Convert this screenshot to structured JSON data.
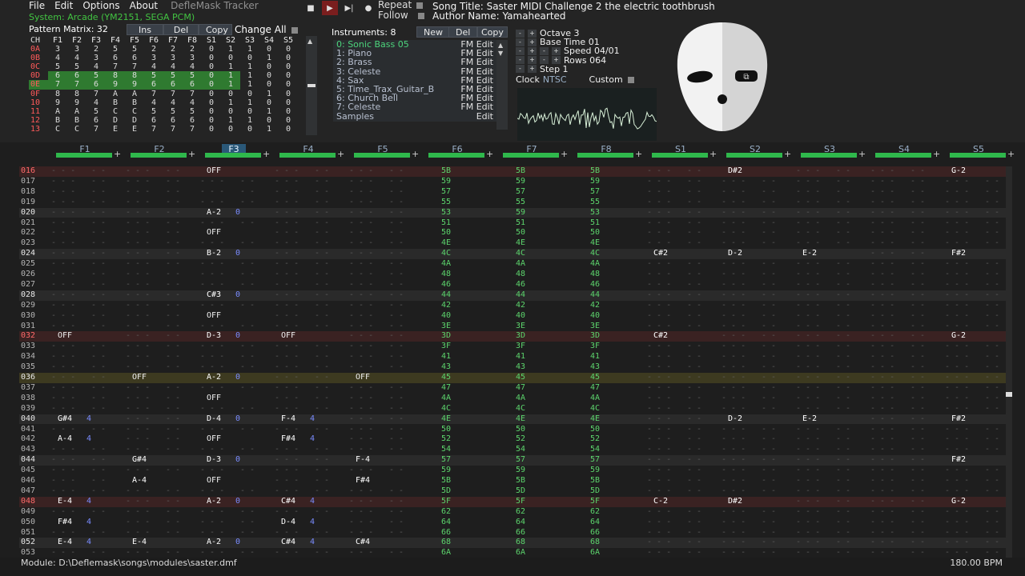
{
  "menu": {
    "file": "File",
    "edit": "Edit",
    "options": "Options",
    "about": "About",
    "app_title": "DefleMask Tracker"
  },
  "system": "System: Arcade (YM2151, SEGA PCM)",
  "transport": {
    "repeat": "Repeat",
    "follow": "Follow"
  },
  "song": {
    "title": "Song Title: Saster MIDI Challenge 2 the electric toothbrush",
    "author": "Author Name: Yamahearted"
  },
  "pattern_matrix": {
    "title": "Pattern Matrix: 32",
    "buttons": {
      "ins": "Ins",
      "del": "Del",
      "copy": "Copy",
      "change_all": "Change All"
    },
    "headers": [
      "CH",
      "F1",
      "F2",
      "F3",
      "F4",
      "F5",
      "F6",
      "F7",
      "F8",
      "S1",
      "S2",
      "S3",
      "S4",
      "S5"
    ],
    "rows": [
      [
        "0A",
        "3",
        "3",
        "2",
        "5",
        "5",
        "2",
        "2",
        "2",
        "0",
        "1",
        "1",
        "0",
        "0"
      ],
      [
        "0B",
        "4",
        "4",
        "3",
        "6",
        "6",
        "3",
        "3",
        "3",
        "0",
        "0",
        "0",
        "1",
        "0"
      ],
      [
        "0C",
        "5",
        "5",
        "4",
        "7",
        "7",
        "4",
        "4",
        "4",
        "0",
        "1",
        "1",
        "0",
        "0"
      ],
      [
        "0D",
        "6",
        "6",
        "5",
        "8",
        "8",
        "5",
        "5",
        "5",
        "0",
        "1",
        "1",
        "0",
        "0"
      ],
      [
        "0E",
        "7",
        "7",
        "6",
        "9",
        "9",
        "6",
        "6",
        "6",
        "0",
        "1",
        "1",
        "0",
        "0"
      ],
      [
        "0F",
        "8",
        "8",
        "7",
        "A",
        "A",
        "7",
        "7",
        "7",
        "0",
        "0",
        "0",
        "1",
        "0"
      ],
      [
        "10",
        "9",
        "9",
        "4",
        "B",
        "B",
        "4",
        "4",
        "4",
        "0",
        "1",
        "1",
        "0",
        "0"
      ],
      [
        "11",
        "A",
        "A",
        "5",
        "C",
        "C",
        "5",
        "5",
        "5",
        "0",
        "0",
        "0",
        "1",
        "0"
      ],
      [
        "12",
        "B",
        "B",
        "6",
        "D",
        "D",
        "6",
        "6",
        "6",
        "0",
        "1",
        "1",
        "0",
        "0"
      ],
      [
        "13",
        "C",
        "C",
        "7",
        "E",
        "E",
        "7",
        "7",
        "7",
        "0",
        "0",
        "0",
        "1",
        "0"
      ]
    ]
  },
  "instruments": {
    "title": "Instruments: 8",
    "buttons": {
      "new": "New",
      "del": "Del",
      "copy": "Copy"
    },
    "items": [
      {
        "name": "0: Sonic Bass 05",
        "type": "FM",
        "action": "Edit"
      },
      {
        "name": "1: Piano",
        "type": "FM",
        "action": "Edit"
      },
      {
        "name": "2: Brass",
        "type": "FM",
        "action": "Edit"
      },
      {
        "name": "3: Celeste",
        "type": "FM",
        "action": "Edit"
      },
      {
        "name": "4: Sax",
        "type": "FM",
        "action": "Edit"
      },
      {
        "name": "5: Time_Trax_Guitar_B",
        "type": "FM",
        "action": "Edit"
      },
      {
        "name": "6: Church Bell",
        "type": "FM",
        "action": "Edit"
      },
      {
        "name": "7: Celeste",
        "type": "FM",
        "action": "Edit"
      },
      {
        "name": "Samples",
        "type": "",
        "action": "Edit"
      }
    ]
  },
  "controls": {
    "octave": "Octave 3",
    "base_time": "Base Time 01",
    "speed": "Speed 04/01",
    "rows": "Rows 064",
    "step": "Step 1",
    "clock": "Clock",
    "ntsc": "NTSC",
    "custom": "Custom"
  },
  "channels": [
    "F1",
    "F2",
    "F3",
    "F4",
    "F5",
    "F6",
    "F7",
    "F8",
    "S1",
    "S2",
    "S3",
    "S4",
    "S5"
  ],
  "active_channel": "F3",
  "pattern": {
    "rows": [
      {
        "n": "016",
        "cells": {
          "2": [
            "OFF",
            ""
          ],
          "5": [
            "5B",
            ""
          ],
          "6": [
            "5B",
            ""
          ],
          "7": [
            "5B",
            ""
          ],
          "9": [
            "D#2",
            ""
          ],
          "12": [
            "G-2",
            ""
          ]
        }
      },
      {
        "n": "017",
        "cells": {
          "5": [
            "59",
            ""
          ],
          "6": [
            "59",
            ""
          ],
          "7": [
            "59",
            ""
          ]
        }
      },
      {
        "n": "018",
        "cells": {
          "5": [
            "57",
            ""
          ],
          "6": [
            "57",
            ""
          ],
          "7": [
            "57",
            ""
          ]
        }
      },
      {
        "n": "019",
        "cells": {
          "5": [
            "55",
            ""
          ],
          "6": [
            "55",
            ""
          ],
          "7": [
            "55",
            ""
          ]
        }
      },
      {
        "n": "020",
        "cells": {
          "2": [
            "A-2",
            "0"
          ],
          "5": [
            "53",
            ""
          ],
          "6": [
            "59",
            ""
          ],
          "7": [
            "53",
            ""
          ]
        }
      },
      {
        "n": "021",
        "cells": {
          "5": [
            "51",
            ""
          ],
          "6": [
            "51",
            ""
          ],
          "7": [
            "51",
            ""
          ]
        }
      },
      {
        "n": "022",
        "cells": {
          "2": [
            "OFF",
            ""
          ],
          "5": [
            "50",
            ""
          ],
          "6": [
            "50",
            ""
          ],
          "7": [
            "50",
            ""
          ]
        }
      },
      {
        "n": "023",
        "cells": {
          "5": [
            "4E",
            ""
          ],
          "6": [
            "4E",
            ""
          ],
          "7": [
            "4E",
            ""
          ]
        }
      },
      {
        "n": "024",
        "cells": {
          "2": [
            "B-2",
            "0"
          ],
          "5": [
            "4C",
            ""
          ],
          "6": [
            "4C",
            ""
          ],
          "7": [
            "4C",
            ""
          ],
          "8": [
            "C#2",
            ""
          ],
          "9": [
            "D-2",
            ""
          ],
          "10": [
            "E-2",
            ""
          ],
          "12": [
            "F#2",
            ""
          ]
        }
      },
      {
        "n": "025",
        "cells": {
          "5": [
            "4A",
            ""
          ],
          "6": [
            "4A",
            ""
          ],
          "7": [
            "4A",
            ""
          ]
        }
      },
      {
        "n": "026",
        "cells": {
          "5": [
            "48",
            ""
          ],
          "6": [
            "48",
            ""
          ],
          "7": [
            "48",
            ""
          ]
        }
      },
      {
        "n": "027",
        "cells": {
          "5": [
            "46",
            ""
          ],
          "6": [
            "46",
            ""
          ],
          "7": [
            "46",
            ""
          ]
        }
      },
      {
        "n": "028",
        "cells": {
          "2": [
            "C#3",
            "0"
          ],
          "5": [
            "44",
            ""
          ],
          "6": [
            "44",
            ""
          ],
          "7": [
            "44",
            ""
          ]
        }
      },
      {
        "n": "029",
        "cells": {
          "5": [
            "42",
            ""
          ],
          "6": [
            "42",
            ""
          ],
          "7": [
            "42",
            ""
          ]
        }
      },
      {
        "n": "030",
        "cells": {
          "2": [
            "OFF",
            ""
          ],
          "5": [
            "40",
            ""
          ],
          "6": [
            "40",
            ""
          ],
          "7": [
            "40",
            ""
          ]
        }
      },
      {
        "n": "031",
        "cells": {
          "5": [
            "3E",
            ""
          ],
          "6": [
            "3E",
            ""
          ],
          "7": [
            "3E",
            ""
          ]
        }
      },
      {
        "n": "032",
        "cells": {
          "0": [
            "OFF",
            ""
          ],
          "2": [
            "D-3",
            "0"
          ],
          "3": [
            "OFF",
            ""
          ],
          "5": [
            "3D",
            ""
          ],
          "6": [
            "3D",
            ""
          ],
          "7": [
            "3D",
            ""
          ],
          "8": [
            "C#2",
            ""
          ],
          "12": [
            "G-2",
            ""
          ]
        }
      },
      {
        "n": "033",
        "cells": {
          "5": [
            "3F",
            ""
          ],
          "6": [
            "3F",
            ""
          ],
          "7": [
            "3F",
            ""
          ]
        }
      },
      {
        "n": "034",
        "cells": {
          "5": [
            "41",
            ""
          ],
          "6": [
            "41",
            ""
          ],
          "7": [
            "41",
            ""
          ]
        }
      },
      {
        "n": "035",
        "cells": {
          "5": [
            "43",
            ""
          ],
          "6": [
            "43",
            ""
          ],
          "7": [
            "43",
            ""
          ]
        }
      },
      {
        "n": "036",
        "cells": {
          "1": [
            "OFF",
            ""
          ],
          "2": [
            "A-2",
            "0"
          ],
          "4": [
            "OFF",
            ""
          ],
          "5": [
            "45",
            ""
          ],
          "6": [
            "45",
            ""
          ],
          "7": [
            "45",
            ""
          ]
        }
      },
      {
        "n": "037",
        "cells": {
          "5": [
            "47",
            ""
          ],
          "6": [
            "47",
            ""
          ],
          "7": [
            "47",
            ""
          ]
        }
      },
      {
        "n": "038",
        "cells": {
          "2": [
            "OFF",
            ""
          ],
          "5": [
            "4A",
            ""
          ],
          "6": [
            "4A",
            ""
          ],
          "7": [
            "4A",
            ""
          ]
        }
      },
      {
        "n": "039",
        "cells": {
          "5": [
            "4C",
            ""
          ],
          "6": [
            "4C",
            ""
          ],
          "7": [
            "4C",
            ""
          ]
        }
      },
      {
        "n": "040",
        "cells": {
          "0": [
            "G#4",
            "4"
          ],
          "2": [
            "D-4",
            "0"
          ],
          "3": [
            "F-4",
            "4"
          ],
          "5": [
            "4E",
            ""
          ],
          "6": [
            "4E",
            ""
          ],
          "7": [
            "4E",
            ""
          ],
          "9": [
            "D-2",
            ""
          ],
          "10": [
            "E-2",
            ""
          ],
          "12": [
            "F#2",
            ""
          ]
        }
      },
      {
        "n": "041",
        "cells": {
          "5": [
            "50",
            ""
          ],
          "6": [
            "50",
            ""
          ],
          "7": [
            "50",
            ""
          ]
        }
      },
      {
        "n": "042",
        "cells": {
          "0": [
            "A-4",
            "4"
          ],
          "2": [
            "OFF",
            ""
          ],
          "3": [
            "F#4",
            "4"
          ],
          "5": [
            "52",
            ""
          ],
          "6": [
            "52",
            ""
          ],
          "7": [
            "52",
            ""
          ]
        }
      },
      {
        "n": "043",
        "cells": {
          "5": [
            "54",
            ""
          ],
          "6": [
            "54",
            ""
          ],
          "7": [
            "54",
            ""
          ]
        }
      },
      {
        "n": "044",
        "cells": {
          "1": [
            "G#4",
            ""
          ],
          "2": [
            "D-3",
            "0"
          ],
          "4": [
            "F-4",
            ""
          ],
          "5": [
            "57",
            ""
          ],
          "6": [
            "57",
            ""
          ],
          "7": [
            "57",
            ""
          ],
          "12": [
            "F#2",
            ""
          ]
        }
      },
      {
        "n": "045",
        "cells": {
          "5": [
            "59",
            ""
          ],
          "6": [
            "59",
            ""
          ],
          "7": [
            "59",
            ""
          ]
        }
      },
      {
        "n": "046",
        "cells": {
          "1": [
            "A-4",
            ""
          ],
          "2": [
            "OFF",
            ""
          ],
          "4": [
            "F#4",
            ""
          ],
          "5": [
            "5B",
            ""
          ],
          "6": [
            "5B",
            ""
          ],
          "7": [
            "5B",
            ""
          ]
        }
      },
      {
        "n": "047",
        "cells": {
          "5": [
            "5D",
            ""
          ],
          "6": [
            "5D",
            ""
          ],
          "7": [
            "5D",
            ""
          ]
        }
      },
      {
        "n": "048",
        "cells": {
          "0": [
            "E-4",
            "4"
          ],
          "2": [
            "A-2",
            "0"
          ],
          "3": [
            "C#4",
            "4"
          ],
          "5": [
            "5F",
            ""
          ],
          "6": [
            "5F",
            ""
          ],
          "7": [
            "5F",
            ""
          ],
          "8": [
            "C-2",
            ""
          ],
          "9": [
            "D#2",
            ""
          ],
          "12": [
            "G-2",
            ""
          ]
        }
      },
      {
        "n": "049",
        "cells": {
          "5": [
            "62",
            ""
          ],
          "6": [
            "62",
            ""
          ],
          "7": [
            "62",
            ""
          ]
        }
      },
      {
        "n": "050",
        "cells": {
          "0": [
            "F#4",
            "4"
          ],
          "3": [
            "D-4",
            "4"
          ],
          "5": [
            "64",
            ""
          ],
          "6": [
            "64",
            ""
          ],
          "7": [
            "64",
            ""
          ]
        }
      },
      {
        "n": "051",
        "cells": {
          "5": [
            "66",
            ""
          ],
          "6": [
            "66",
            ""
          ],
          "7": [
            "66",
            ""
          ]
        }
      },
      {
        "n": "052",
        "cells": {
          "0": [
            "E-4",
            "4"
          ],
          "1": [
            "E-4",
            ""
          ],
          "2": [
            "A-2",
            "0"
          ],
          "3": [
            "C#4",
            "4"
          ],
          "4": [
            "C#4",
            ""
          ],
          "5": [
            "68",
            ""
          ],
          "6": [
            "68",
            ""
          ],
          "7": [
            "68",
            ""
          ]
        }
      },
      {
        "n": "053",
        "cells": {
          "5": [
            "6A",
            ""
          ],
          "6": [
            "6A",
            ""
          ],
          "7": [
            "6A",
            ""
          ]
        }
      }
    ]
  },
  "status": {
    "module": "Module: D:\\Deflemask\\songs\\modules\\saster.dmf",
    "bpm": "180.00 BPM"
  },
  "colors": {
    "green": "#2fb84c",
    "active_channel": "#4aa0d0",
    "highlight_row": "#3a2222"
  }
}
